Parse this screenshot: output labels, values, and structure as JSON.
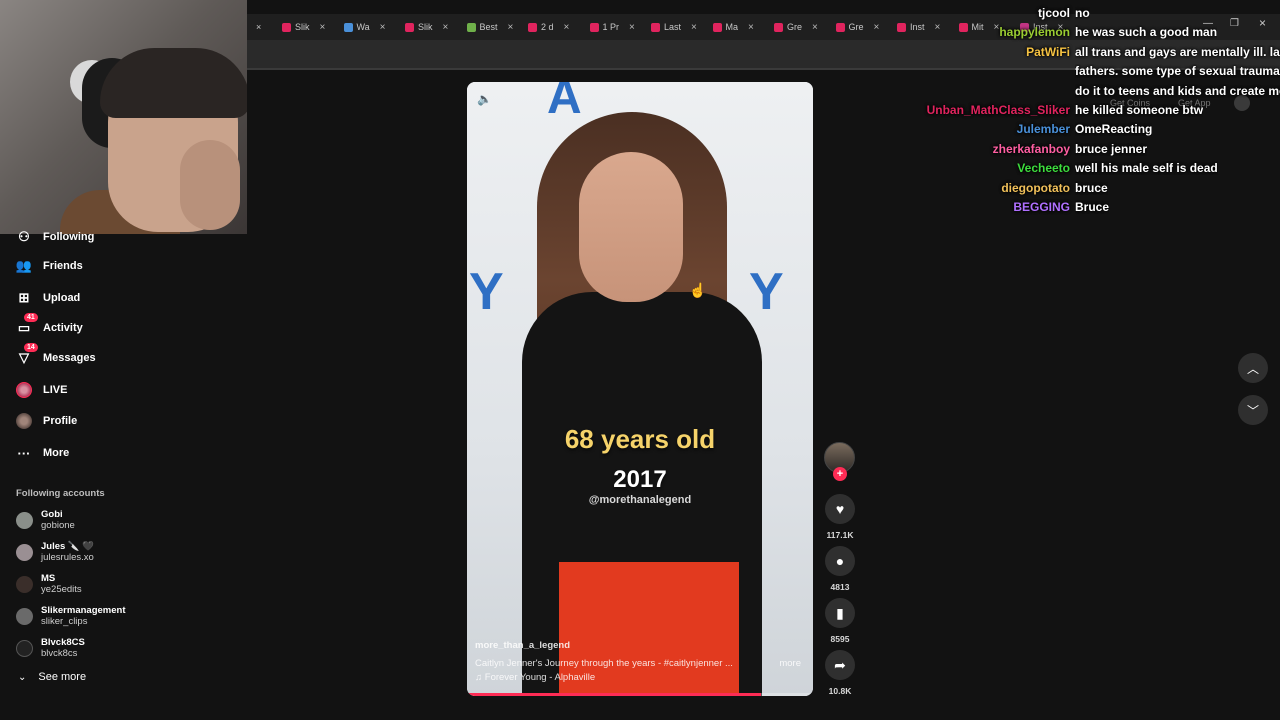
{
  "browser": {
    "tabs": [
      {
        "label": "Slik",
        "color": "#e0245e"
      },
      {
        "label": "Wa",
        "color": "#4a90d9"
      },
      {
        "label": "Slik",
        "color": "#e0245e"
      },
      {
        "label": "Best",
        "color": "#6fb04a"
      },
      {
        "label": "2 d",
        "color": "#e0245e"
      },
      {
        "label": "1 Pr",
        "color": "#e0245e"
      },
      {
        "label": "Last",
        "color": "#e0245e"
      },
      {
        "label": "Ma",
        "color": "#e0245e"
      },
      {
        "label": "Gre",
        "color": "#e0245e"
      },
      {
        "label": "Gre",
        "color": "#e0245e"
      },
      {
        "label": "Inst",
        "color": "#e0245e"
      },
      {
        "label": "Mit",
        "color": "#e0245e"
      },
      {
        "label": "Inst",
        "color": "#c13584"
      }
    ],
    "close_glyph": "×"
  },
  "sidebar": {
    "items": [
      {
        "label": "Following",
        "icon": "following-icon"
      },
      {
        "label": "Friends",
        "icon": "friends-icon"
      },
      {
        "label": "Upload",
        "icon": "upload-icon"
      },
      {
        "label": "Activity",
        "icon": "activity-icon",
        "badge": "41"
      },
      {
        "label": "Messages",
        "icon": "messages-icon",
        "badge": "14"
      },
      {
        "label": "LIVE",
        "icon": "live-icon"
      },
      {
        "label": "Profile",
        "icon": "profile-icon"
      },
      {
        "label": "More",
        "icon": "more-icon"
      }
    ],
    "following_title": "Following accounts",
    "accounts": [
      {
        "name": "Gobi",
        "handle": "gobione"
      },
      {
        "name": "Jules 🔪 🖤",
        "handle": "julesrules.xo"
      },
      {
        "name": "MS",
        "handle": "ye25edits"
      },
      {
        "name": "Slikermanagement",
        "handle": "sliker_clips"
      },
      {
        "name": "Blvck8CS",
        "handle": "blvck8cs"
      }
    ],
    "see_more": "See more"
  },
  "video": {
    "overlay_age": "68 years old",
    "overlay_year": "2017",
    "overlay_handle": "@morethanalegend",
    "author": "more_than_a_legend",
    "caption": "Caitlyn Jenner's Journey through the years - #caitlynjenner ...",
    "more_label": "more",
    "music": "♫ Forever Young - Alphaville",
    "progress": 0.85
  },
  "actions": {
    "likes": "117.1K",
    "comments": "4813",
    "saves": "8595",
    "shares": "10.8K"
  },
  "tiktok_header": {
    "get_coins": "Get Coins",
    "get_app": "Get App"
  },
  "chat": [
    {
      "user": "tjcool",
      "color": "#ffffff",
      "msg": "no"
    },
    {
      "user": "happylemon",
      "color": "#9acd32",
      "msg": "he was such a good man"
    },
    {
      "user": "PatWiFi",
      "color": "#f5c242",
      "msg": "all trans and gays are mentally ill. lack"
    },
    {
      "user": "",
      "color": "#ffffff",
      "msg": "fathers. some type of sexual trauma. t"
    },
    {
      "user": "",
      "color": "#ffffff",
      "msg": "do it to teens and kids and create mor"
    },
    {
      "user": "Unban_MathClass_Sliker",
      "color": "#e0245e",
      "msg": "he killed someone btw"
    },
    {
      "user": "Julember",
      "color": "#4a90d9",
      "msg": "OmeReacting"
    },
    {
      "user": "zherkafanboy",
      "color": "#ff5fa2",
      "msg": "bruce jenner"
    },
    {
      "user": "Vecheeto",
      "color": "#3ddc3d",
      "msg": "well his male self is dead"
    },
    {
      "user": "diegopotato",
      "color": "#f0c05a",
      "msg": "bruce"
    },
    {
      "user": "BEGGING",
      "color": "#b070ff",
      "msg": "Bruce"
    }
  ]
}
